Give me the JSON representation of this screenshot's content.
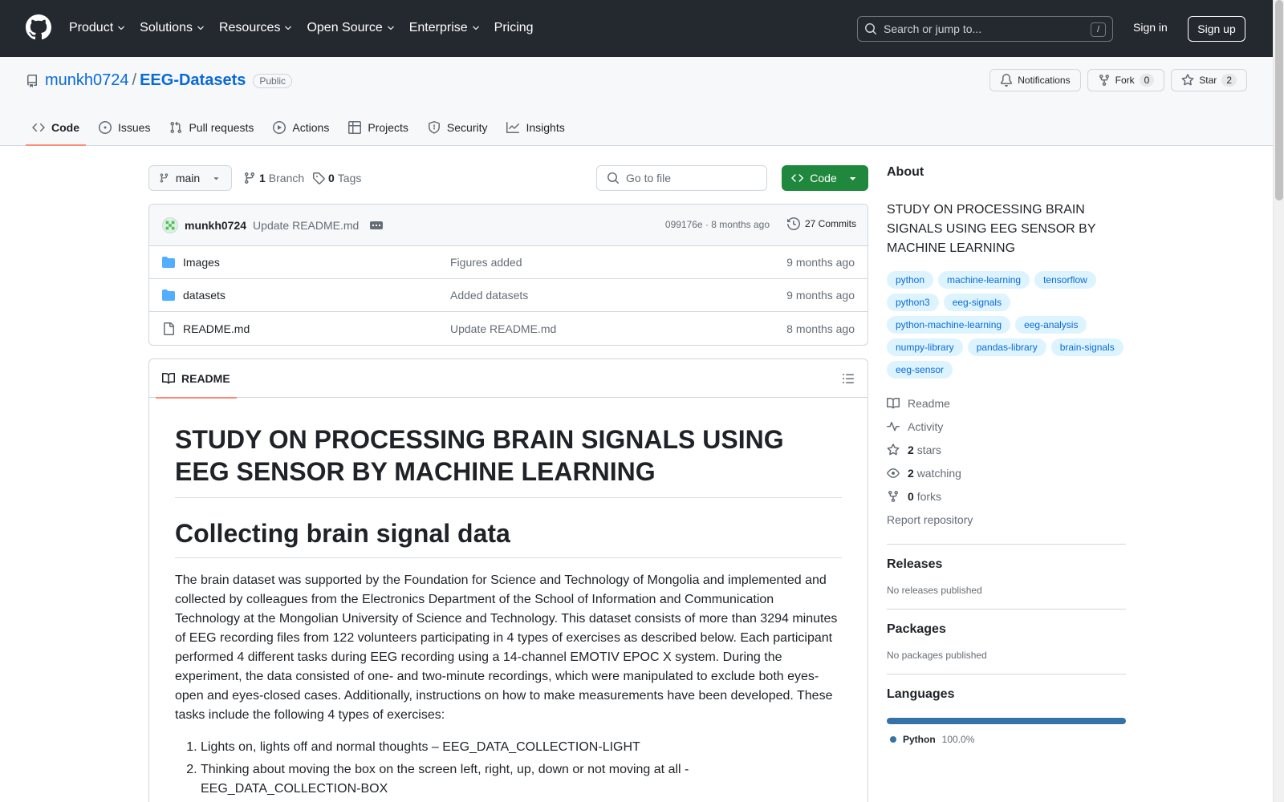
{
  "header": {
    "nav": [
      {
        "label": "Product",
        "dropdown": true
      },
      {
        "label": "Solutions",
        "dropdown": true
      },
      {
        "label": "Resources",
        "dropdown": true
      },
      {
        "label": "Open Source",
        "dropdown": true
      },
      {
        "label": "Enterprise",
        "dropdown": true
      },
      {
        "label": "Pricing",
        "dropdown": false
      }
    ],
    "search_placeholder": "Search or jump to...",
    "search_key": "/",
    "sign_in": "Sign in",
    "sign_up": "Sign up"
  },
  "repo": {
    "owner": "munkh0724",
    "separator": "/",
    "name": "EEG-Datasets",
    "visibility": "Public",
    "notifications_label": "Notifications",
    "fork_label": "Fork",
    "fork_count": "0",
    "star_label": "Star",
    "star_count": "2",
    "tabs": [
      {
        "label": "Code",
        "icon": "code-icon",
        "active": true
      },
      {
        "label": "Issues",
        "icon": "issue-icon",
        "active": false
      },
      {
        "label": "Pull requests",
        "icon": "pull-request-icon",
        "active": false
      },
      {
        "label": "Actions",
        "icon": "play-icon",
        "active": false
      },
      {
        "label": "Projects",
        "icon": "table-icon",
        "active": false
      },
      {
        "label": "Security",
        "icon": "shield-icon",
        "active": false
      },
      {
        "label": "Insights",
        "icon": "graph-icon",
        "active": false
      }
    ]
  },
  "toolbar": {
    "branch": "main",
    "branch_count": "1",
    "branch_label": "Branch",
    "tag_count": "0",
    "tag_label": "Tags",
    "goto_placeholder": "Go to file",
    "code_button": "Code"
  },
  "commit": {
    "user": "munkh0724",
    "message": "Update README.md",
    "meta": "099176e · 8 months ago",
    "commits_label": "27 Commits"
  },
  "files": [
    {
      "name": "Images",
      "type": "folder",
      "commit": "Figures added",
      "age": "9 months ago"
    },
    {
      "name": "datasets",
      "type": "folder",
      "commit": "Added datasets",
      "age": "9 months ago"
    },
    {
      "name": "README.md",
      "type": "file",
      "commit": "Update README.md",
      "age": "8 months ago"
    }
  ],
  "readme": {
    "tab_label": "README",
    "h1": "STUDY ON PROCESSING BRAIN SIGNALS USING EEG SENSOR BY MACHINE LEARNING",
    "h2": "Collecting brain signal data",
    "paragraph": "The brain dataset was supported by the Foundation for Science and Technology of Mongolia and implemented and collected by colleagues from the Electronics Department of the School of Information and Communication Technology at the Mongolian University of Science and Technology. This dataset consists of more than 3294 minutes of EEG recording files from 122 volunteers participating in 4 types of exercises as described below. Each participant performed 4 different tasks during EEG recording using a 14-channel EMOTIV EPOC X system. During the experiment, the data consisted of one- and two-minute recordings, which were manipulated to exclude both eyes-open and eyes-closed cases. Additionally, instructions on how to make measurements have been developed. These tasks include the following 4 types of exercises:",
    "list": [
      "Lights on, lights off and normal thoughts – EEG_DATA_COLLECTION-LIGHT",
      "Thinking about moving the box on the screen left, right, up, down or not moving at all - EEG_DATA_COLLECTION-BOX"
    ]
  },
  "about": {
    "heading": "About",
    "description": "STUDY ON PROCESSING BRAIN SIGNALS USING EEG SENSOR BY MACHINE LEARNING",
    "topics": [
      "python",
      "machine-learning",
      "tensorflow",
      "python3",
      "eeg-signals",
      "python-machine-learning",
      "eeg-analysis",
      "numpy-library",
      "pandas-library",
      "brain-signals",
      "eeg-sensor"
    ],
    "links": [
      {
        "icon": "book-icon",
        "count": "",
        "label": "Readme"
      },
      {
        "icon": "pulse-icon",
        "count": "",
        "label": "Activity"
      },
      {
        "icon": "star-icon",
        "count": "2",
        "label": "stars"
      },
      {
        "icon": "eye-icon",
        "count": "2",
        "label": "watching"
      },
      {
        "icon": "fork-icon",
        "count": "0",
        "label": "forks"
      }
    ],
    "report": "Report repository"
  },
  "releases": {
    "heading": "Releases",
    "text": "No releases published"
  },
  "packages": {
    "heading": "Packages",
    "text": "No packages published"
  },
  "languages": {
    "heading": "Languages",
    "items": [
      {
        "name": "Python",
        "percent": "100.0%",
        "fraction": 1.0,
        "color": "#3572a5"
      }
    ]
  },
  "colors": {
    "accent": "#0969da",
    "primary_button": "#1f883d",
    "header_bg": "#24292f",
    "tab_underline": "#fd8c73"
  }
}
